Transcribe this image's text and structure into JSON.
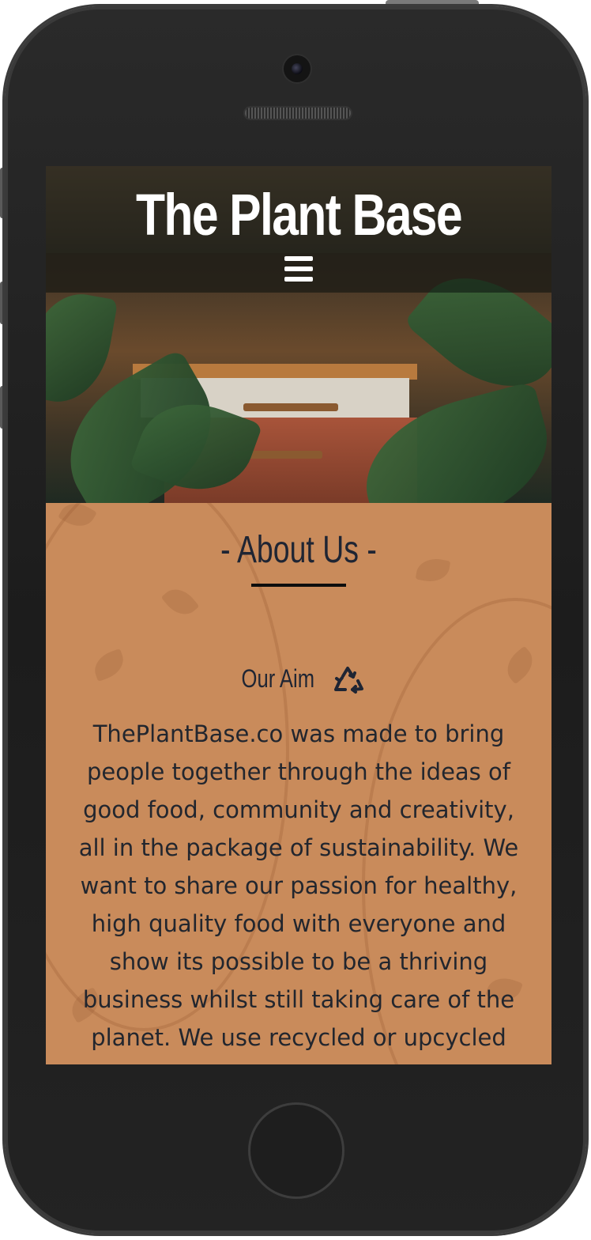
{
  "header": {
    "site_title": "The Plant Base",
    "menu_icon": "hamburger-menu-icon"
  },
  "about": {
    "title": "- About Us -",
    "aim_heading": "Our Aim",
    "aim_icon": "recycle-icon",
    "paragraph": "ThePlantBase.co was made to bring people together through the ideas of good food, community and creativity, all in the package of sustainability. We want to share our passion for healthy, high quality food with everyone and show its possible to be a thriving business whilst still taking care of the planet. We use recycled or upcycled materials for the"
  },
  "colors": {
    "about_background": "#c98b5b",
    "heading_text": "#1f2533",
    "title_text": "#ffffff"
  }
}
